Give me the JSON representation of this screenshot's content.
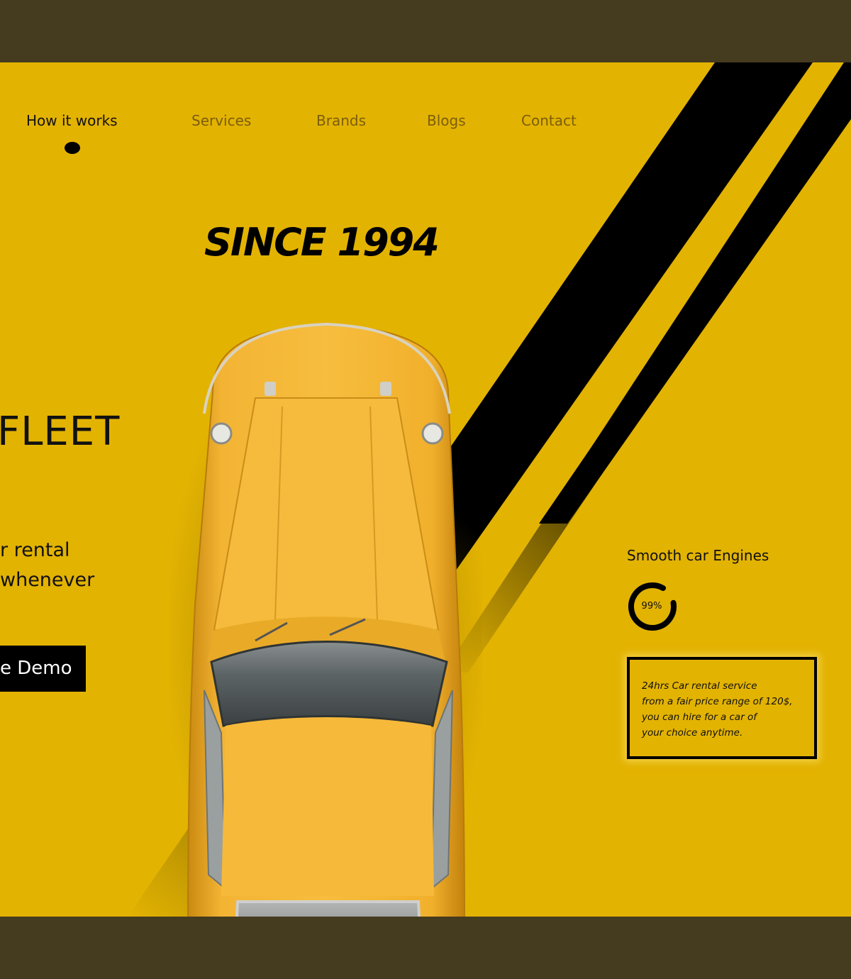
{
  "nav": {
    "items": [
      {
        "label": "How it works",
        "active": true
      },
      {
        "label": "Services",
        "active": false
      },
      {
        "label": "Brands",
        "active": false
      },
      {
        "label": "Blogs",
        "active": false
      },
      {
        "label": "Contact",
        "active": false
      }
    ]
  },
  "hero": {
    "since": "SINCE 1994",
    "heading_fragment": "FLEET",
    "description_lines": [
      "r rental",
      "whenever"
    ],
    "demo_button_label": "e Demo"
  },
  "stats": {
    "title": "Smooth car Engines",
    "gauge_label": "99%",
    "gauge_value": 0.99
  },
  "info_box": {
    "lines": [
      "24hrs Car rental service",
      "from a fair price range of 120$,",
      "you can hire for a car of",
      "your choice anytime."
    ]
  },
  "colors": {
    "accent_yellow": "#e3b302",
    "band": "#453b1e",
    "car_body": "#f0a81c",
    "stripe": "#000000"
  }
}
